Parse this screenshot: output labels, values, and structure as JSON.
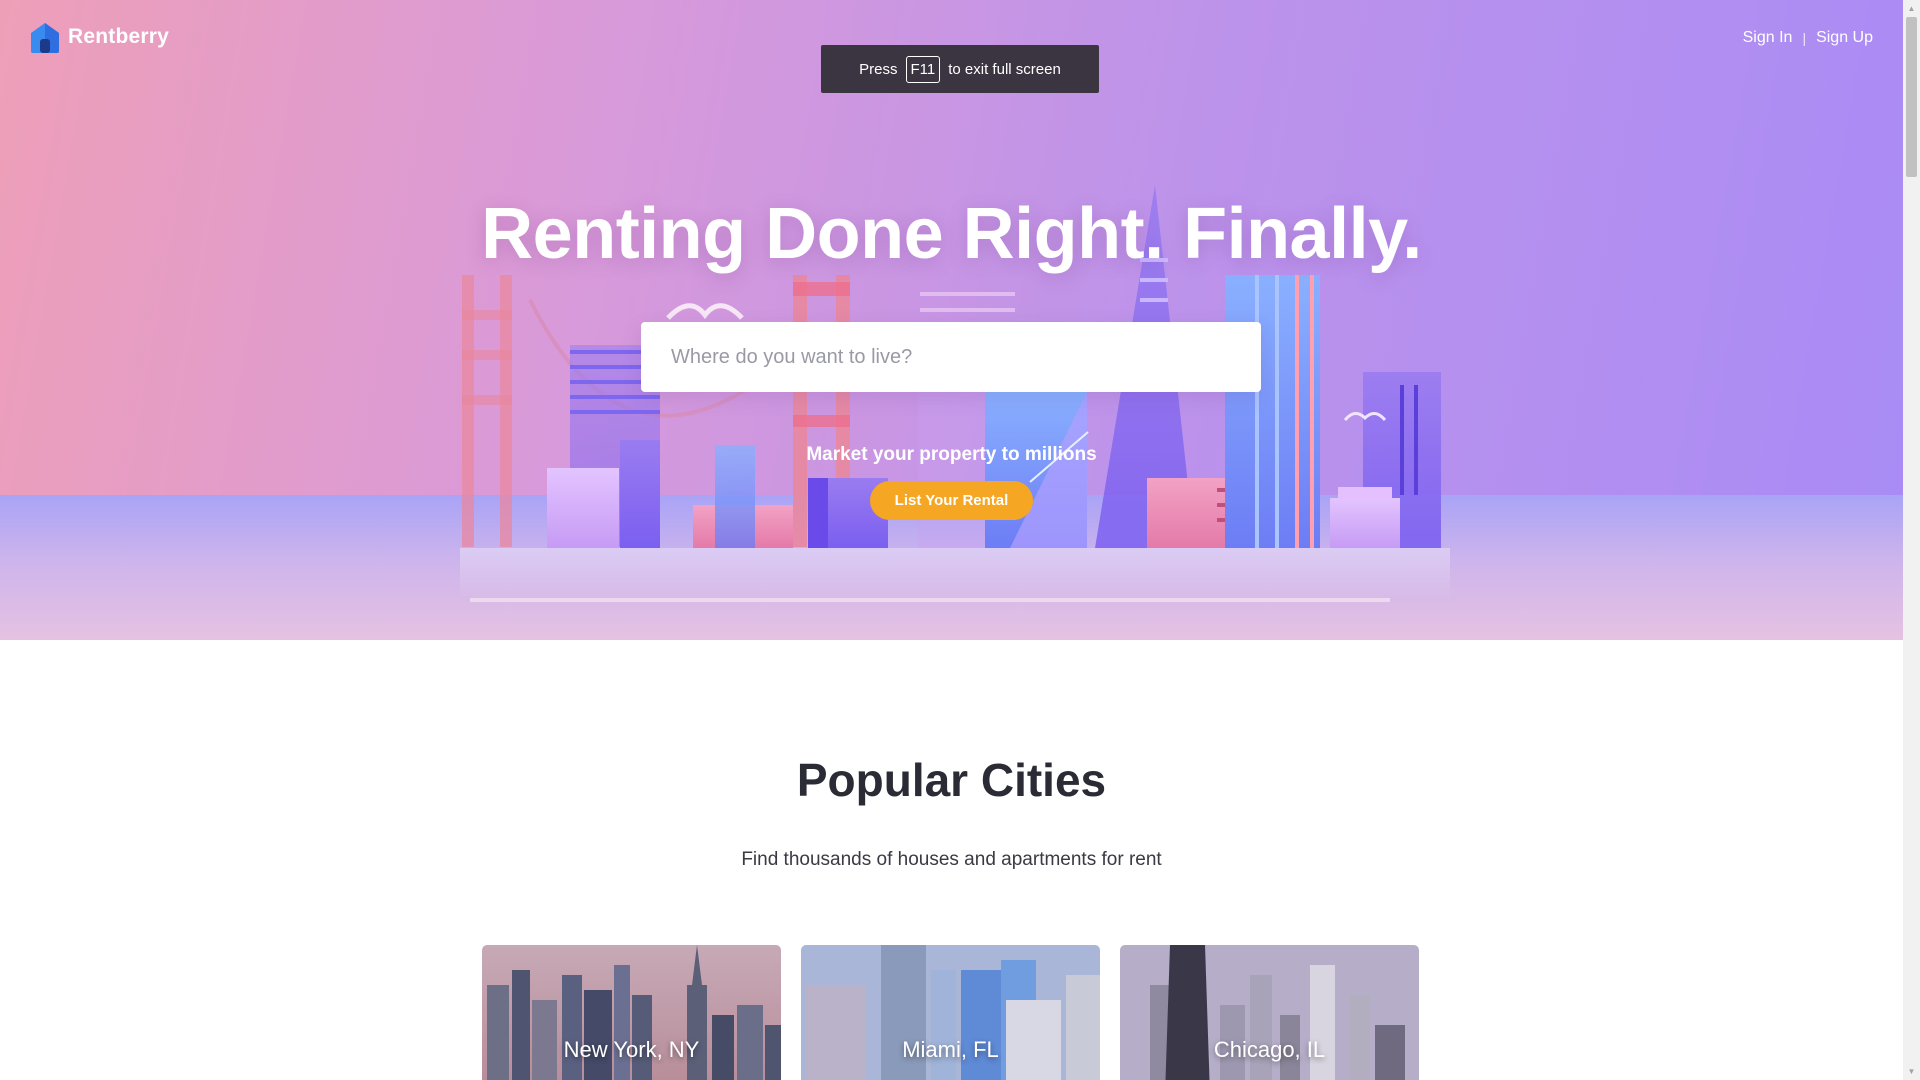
{
  "brand": {
    "name": "Rentberry"
  },
  "auth": {
    "sign_in": "Sign In",
    "separator": "|",
    "sign_up": "Sign Up"
  },
  "fullscreen_banner": {
    "prefix": "Press",
    "key": "F11",
    "suffix": "to exit full screen"
  },
  "hero": {
    "title": "Renting Done Right. Finally.",
    "search_placeholder": "Where do you want to live?",
    "market_text": "Market your property to millions",
    "cta_label": "List Your Rental"
  },
  "popular": {
    "title": "Popular Cities",
    "subtitle": "Find thousands of houses and apartments for rent",
    "cities": [
      {
        "name": "New York, NY"
      },
      {
        "name": "Miami, FL"
      },
      {
        "name": "Chicago, IL"
      }
    ]
  },
  "colors": {
    "accent": "#f5a623",
    "hero_gradient_start": "#ee9fb8",
    "hero_gradient_end": "#a98bf6",
    "heading": "#2b2b36"
  },
  "icons": {
    "logo": "house-logo-icon",
    "scroll_up": "scroll-up-arrow-icon",
    "scroll_down": "scroll-down-arrow-icon"
  }
}
